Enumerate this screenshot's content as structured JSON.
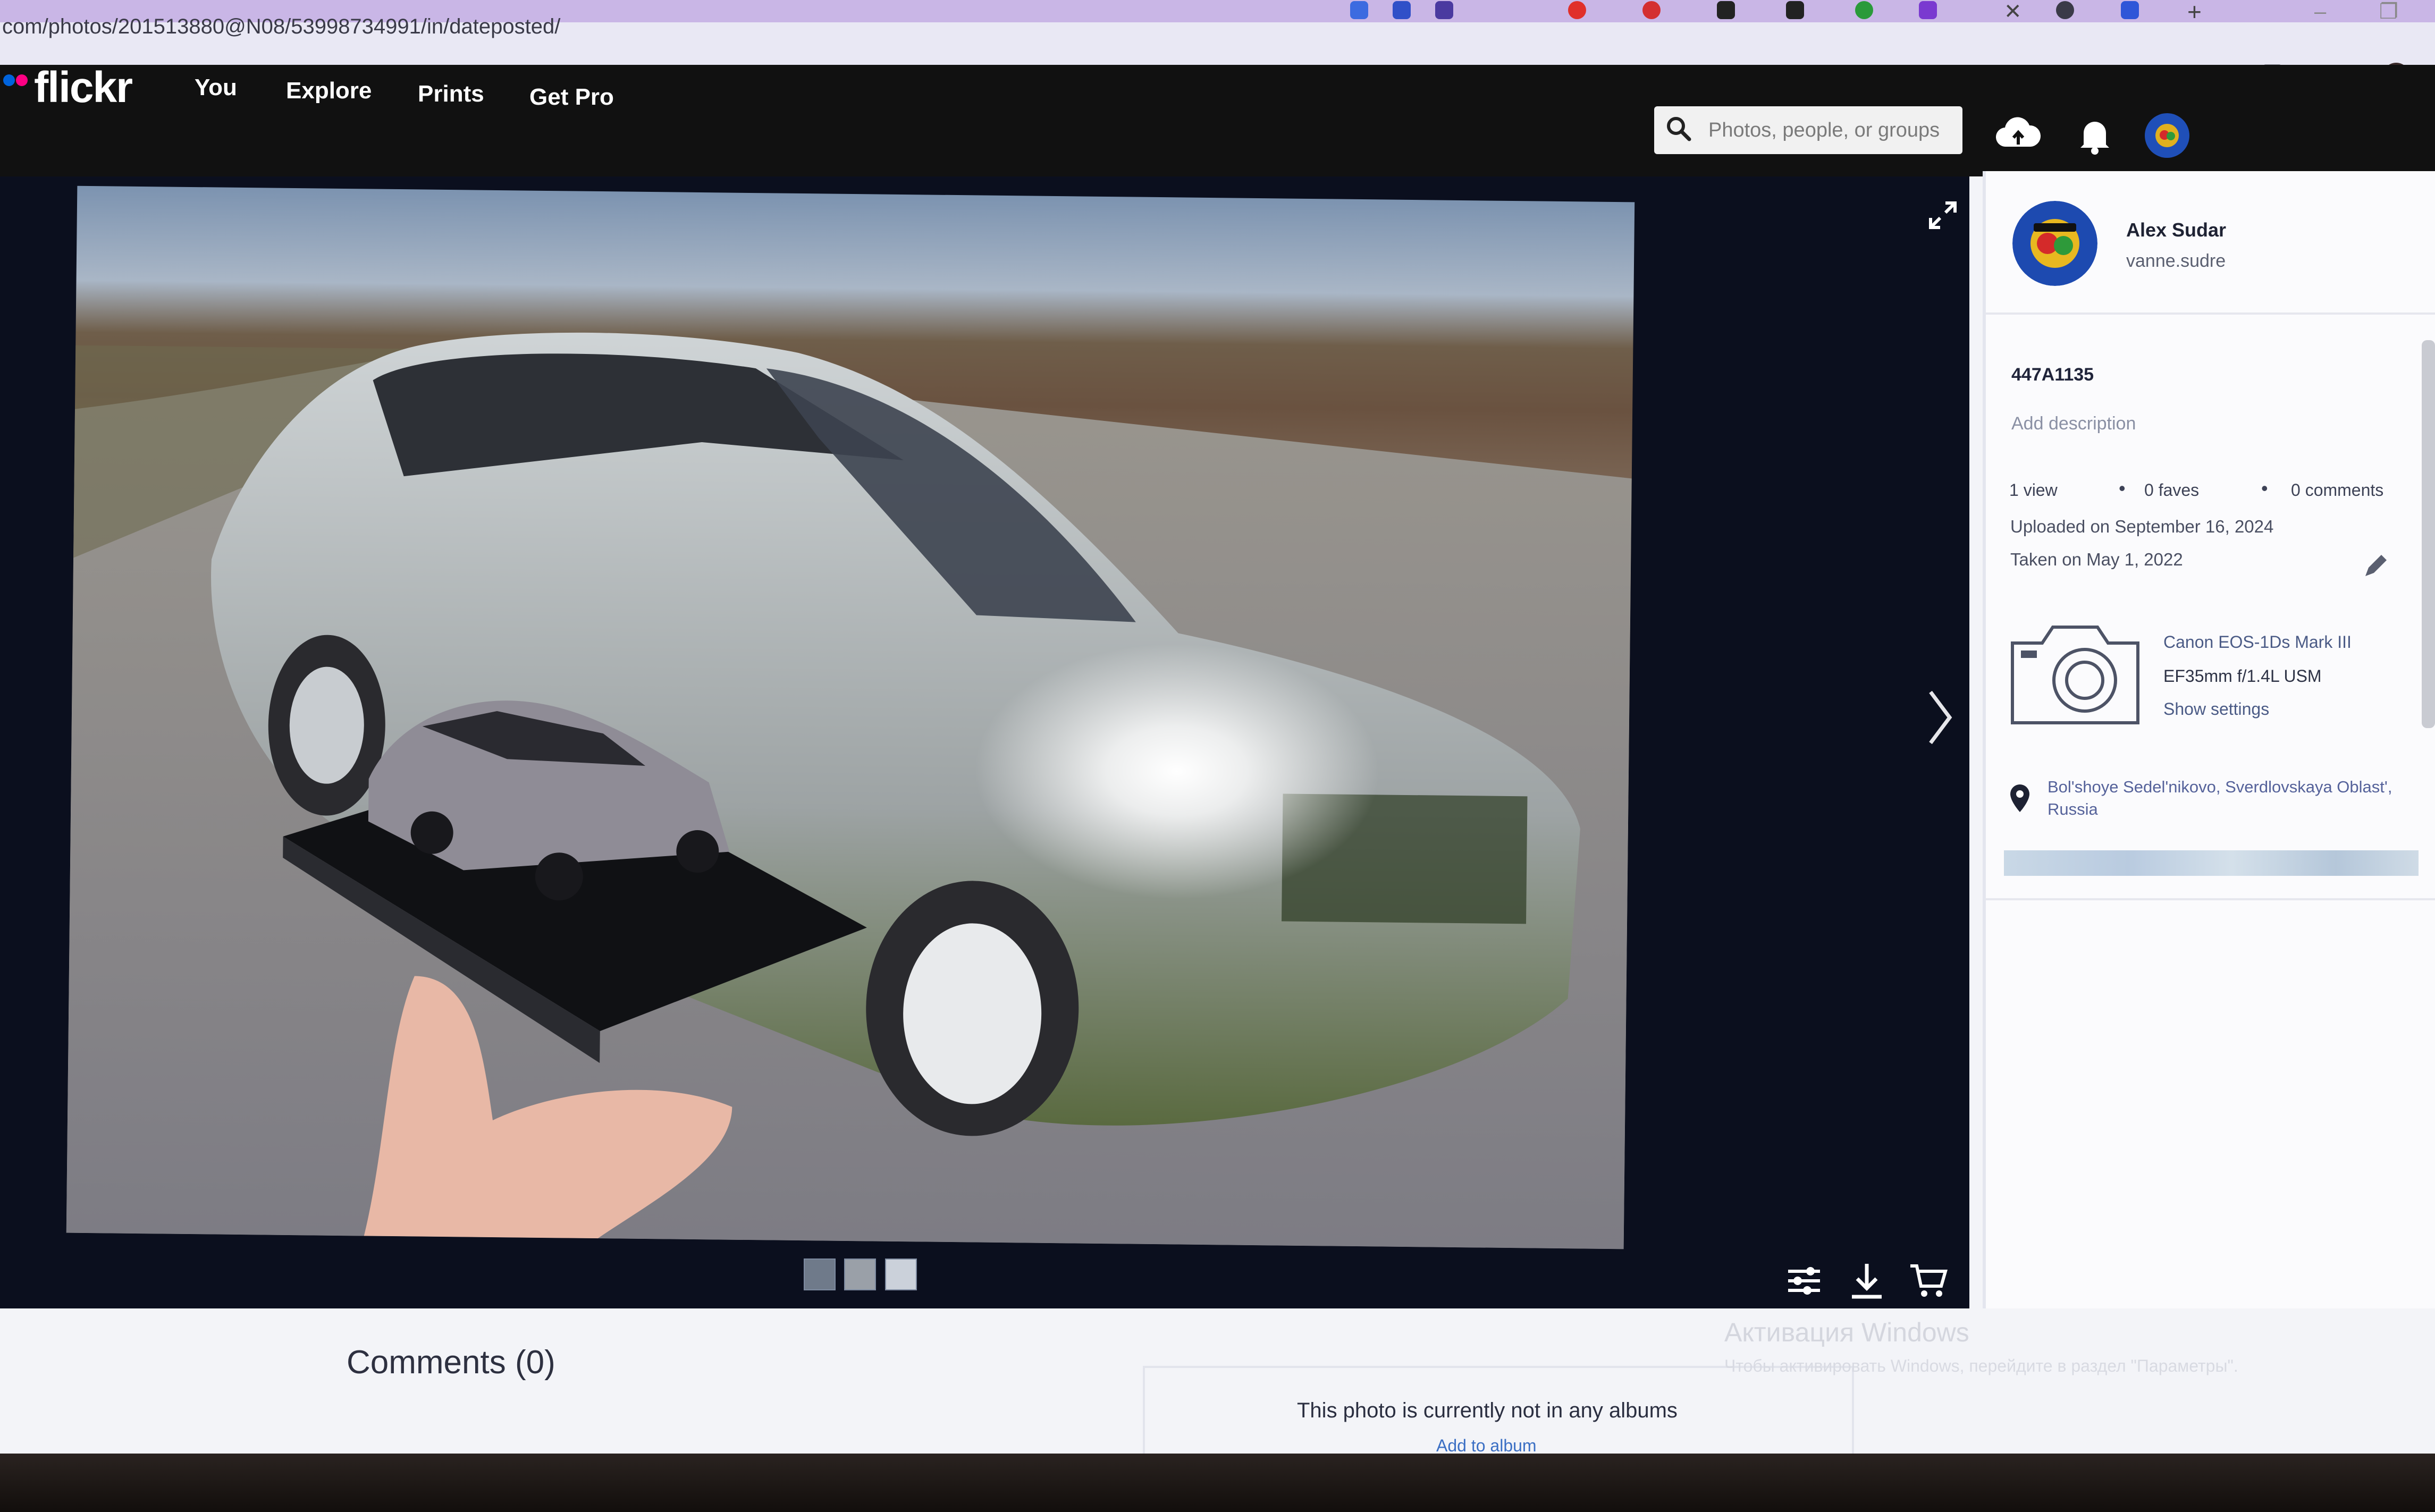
{
  "browser": {
    "url": "com/photos/201513880@N08/53998734991/in/dateposted/",
    "new_tab": "+",
    "close_tab": "✕"
  },
  "header": {
    "logo": "flickr",
    "nav": [
      "You",
      "Explore",
      "Prints",
      "Get Pro"
    ],
    "search_placeholder": "Photos, people, or groups"
  },
  "photo_panel": {
    "author_name": "Alex Sudar",
    "author_username": "vanne.sudre",
    "title": "447A1135",
    "description_placeholder": "Add description",
    "views": "1 view",
    "faves": "0 faves",
    "comments_count": "0 comments",
    "uploaded": "Uploaded on September 16, 2024",
    "taken": "Taken on May 1, 2022",
    "camera": "Canon EOS-1Ds Mark III",
    "lens": "EF35mm f/1.4L USM",
    "show_settings": "Show settings",
    "location": "Bol'shoye Sedel'nikovo, Sverdlovskaya Oblast', Russia"
  },
  "below": {
    "comments_heading": "Comments (0)",
    "album_message": "This photo is currently not in any albums",
    "add_to_album": "Add to album"
  },
  "windows_activation": {
    "line1": "Активация Windows",
    "line2": "Чтобы активировать Windows, перейдите в раздел \"Параметры\"."
  },
  "colors": {
    "flickr_pink": "#ff0084",
    "flickr_blue": "#0063dc",
    "header_bg": "#111111",
    "stage_bg": "#0b0f1e",
    "link": "#3b6fc4"
  }
}
